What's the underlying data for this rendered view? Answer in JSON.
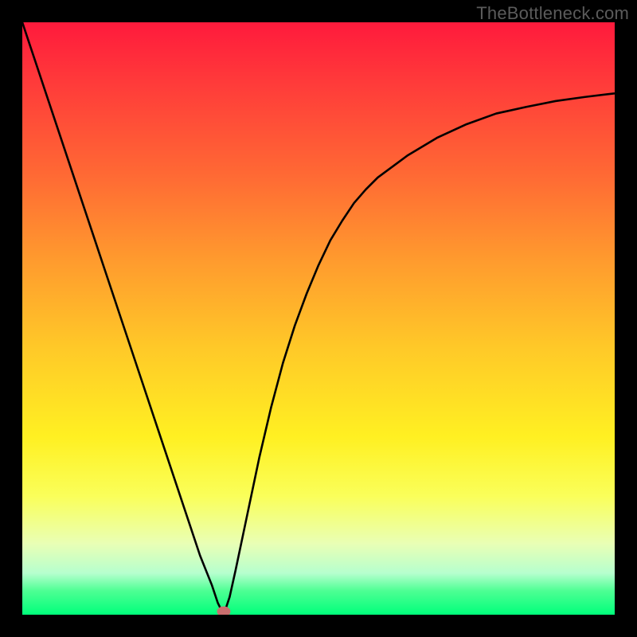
{
  "watermark": "TheBottleneck.com",
  "chart_data": {
    "type": "line",
    "title": "",
    "xlabel": "",
    "ylabel": "",
    "xlim": [
      0,
      1
    ],
    "ylim": [
      0,
      1
    ],
    "x": [
      0.0,
      0.02,
      0.04,
      0.06,
      0.08,
      0.1,
      0.12,
      0.14,
      0.16,
      0.18,
      0.2,
      0.22,
      0.24,
      0.26,
      0.28,
      0.3,
      0.32,
      0.33,
      0.34,
      0.35,
      0.36,
      0.38,
      0.4,
      0.42,
      0.44,
      0.46,
      0.48,
      0.5,
      0.52,
      0.54,
      0.56,
      0.58,
      0.6,
      0.65,
      0.7,
      0.75,
      0.8,
      0.85,
      0.9,
      0.95,
      1.0
    ],
    "values": [
      1.0,
      0.94,
      0.88,
      0.82,
      0.76,
      0.7,
      0.64,
      0.58,
      0.52,
      0.46,
      0.4,
      0.34,
      0.28,
      0.22,
      0.16,
      0.1,
      0.05,
      0.02,
      0.0,
      0.03,
      0.075,
      0.17,
      0.265,
      0.35,
      0.425,
      0.488,
      0.542,
      0.59,
      0.632,
      0.665,
      0.695,
      0.718,
      0.738,
      0.775,
      0.805,
      0.828,
      0.846,
      0.857,
      0.867,
      0.874,
      0.88
    ],
    "marker": {
      "x": 0.34,
      "y": 0.0
    },
    "legend": [],
    "grid": false
  }
}
